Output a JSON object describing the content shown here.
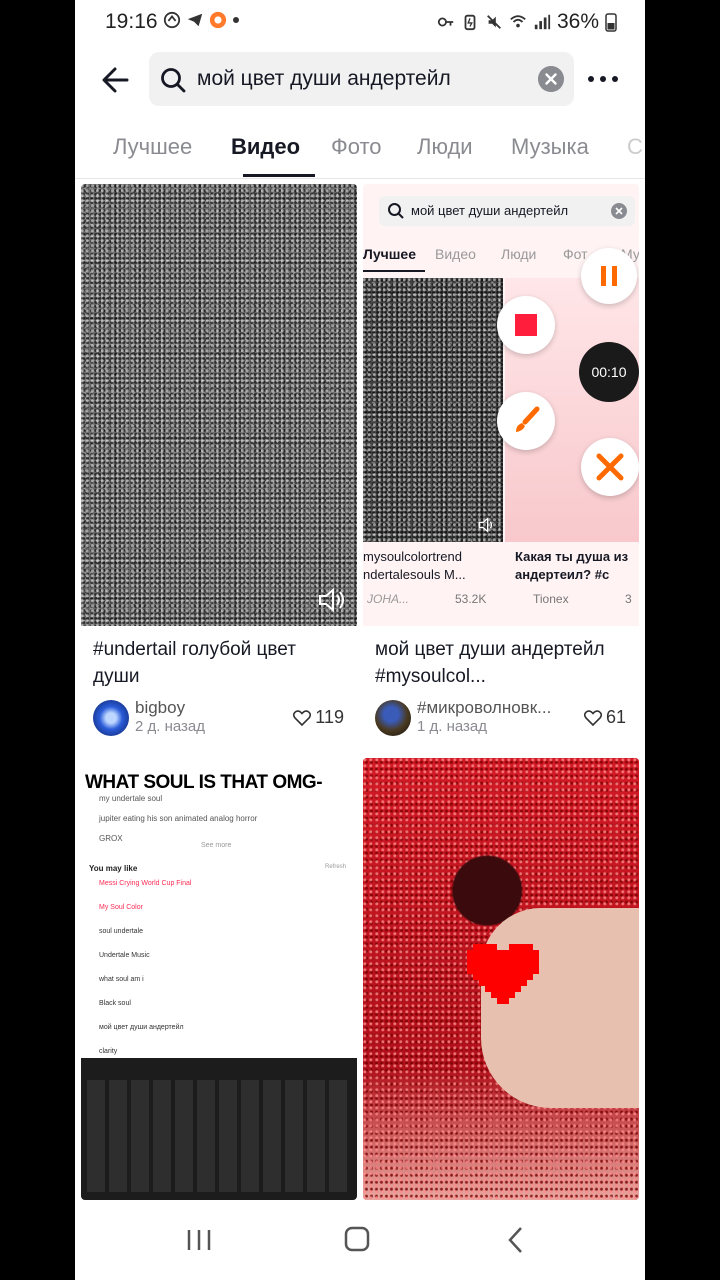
{
  "status": {
    "time": "19:16",
    "battery": "36%"
  },
  "search": {
    "query": "мой цвет души андертейл"
  },
  "tabs": [
    {
      "label": "Лучшее"
    },
    {
      "label": "Видео"
    },
    {
      "label": "Фото"
    },
    {
      "label": "Люди"
    },
    {
      "label": "Музыка"
    },
    {
      "label": "С"
    }
  ],
  "cards": [
    {
      "title": "#undertail голубой цвет души",
      "author": "bigboy",
      "date": "2 д. назад",
      "likes": "119"
    },
    {
      "title": "мой цвет души андертейл #mysoulcol...",
      "author": "#микроволновк...",
      "date": "1 д. назад",
      "likes": "61",
      "inner": {
        "search_text": "мой цвет души андертейл",
        "tabs": [
          "Лучшее",
          "Видео",
          "Люди",
          "Фот",
          "Му"
        ],
        "item1_title": "mysoulcolortrend ndertalesouls M...",
        "item1_author": "ЈОНА...",
        "item1_likes": "53.2K",
        "item2_title": "Какая ты душа из андертеил? #с",
        "item2_author": "Tionex",
        "item2_likes": "3",
        "timer": "00:10"
      }
    },
    {
      "caption": "WHAT SOUL IS THAT OMG-",
      "list_header": "You may like",
      "see_more": "See more",
      "refresh": "Refresh",
      "history": [
        "my undertale soul",
        "jupiter eating his son animated analog horror",
        "GROX"
      ],
      "suggestions": [
        "Messi Crying World Cup Final",
        "My Soul Color",
        "soul undertale",
        "Undertale Music",
        "what soul am i",
        "Black soul",
        "мой цвет души андертейл",
        "clarity"
      ]
    },
    {}
  ],
  "colors": {
    "accent": "#fe2c55",
    "text": "#161823",
    "muted": "#8a8b91",
    "orange": "#ff6a00"
  }
}
